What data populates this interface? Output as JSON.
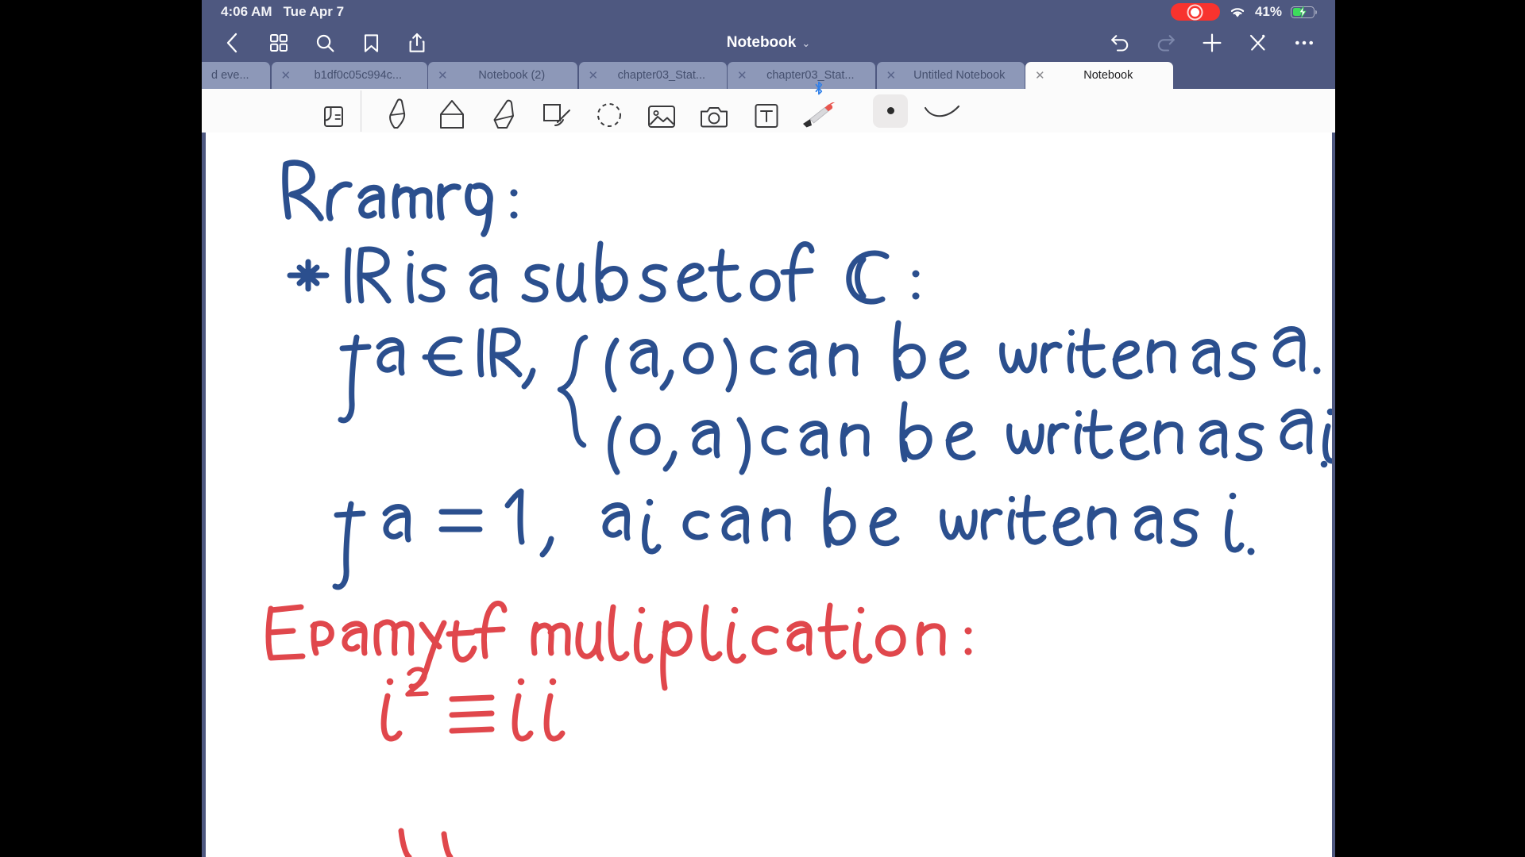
{
  "status_bar": {
    "time": "4:06 AM",
    "date": "Tue Apr 7",
    "recording_label": "recording-indicator",
    "wifi_label": "wifi-icon",
    "battery_percent": "41%",
    "battery_level": 41,
    "battery_charging": true
  },
  "nav_bar": {
    "back_label": "back-chevron",
    "grid_label": "thumbnail-grid",
    "search_label": "search",
    "bookmark_label": "bookmark",
    "share_label": "share",
    "title": "Notebook",
    "title_caret": "⌄",
    "undo_label": "undo",
    "redo_label": "redo",
    "add_label": "add",
    "ai_label": "ai-assist",
    "more_label": "more-options"
  },
  "tabs": [
    {
      "label": "d eve...",
      "closable": false,
      "active": false
    },
    {
      "label": "b1df0c05c994c...",
      "closable": true,
      "active": false
    },
    {
      "label": "Notebook (2)",
      "closable": true,
      "active": false
    },
    {
      "label": "chapter03_Stat...",
      "closable": true,
      "active": false
    },
    {
      "label": "chapter03_Stat...",
      "closable": true,
      "active": false
    },
    {
      "label": "Untitled Notebook",
      "closable": true,
      "active": false
    },
    {
      "label": "Notebook",
      "closable": true,
      "active": true
    }
  ],
  "draw_toolbar": {
    "tools": [
      {
        "name": "read-only-mode-icon"
      },
      {
        "name": "pen-icon"
      },
      {
        "name": "eraser-icon"
      },
      {
        "name": "highlighter-icon"
      },
      {
        "name": "shape-icon"
      },
      {
        "name": "lasso-select-icon"
      },
      {
        "name": "image-icon"
      },
      {
        "name": "camera-icon"
      },
      {
        "name": "text-box-icon"
      },
      {
        "name": "stylus-pencil-icon"
      }
    ],
    "bluetooth_label": "bluetooth-icon",
    "color_swatch": "#2b2b2b",
    "stroke_preview": "stroke-thickness-preview"
  },
  "page_content": {
    "heading": "Remark:",
    "lines": [
      "* IR is a subset of C:",
      "if a ∈ IR ,   (a, o) can be written as a.",
      "(o, a) can be written as ai.",
      "if a = 1 ,   ai can be written as i."
    ],
    "example_heading": "Example of muliplication:",
    "example_line": "i² ≡ i i",
    "ink_color_blue": "#2b4f8e",
    "ink_color_red": "#e0474c",
    "paper_color": "#ffffff"
  }
}
